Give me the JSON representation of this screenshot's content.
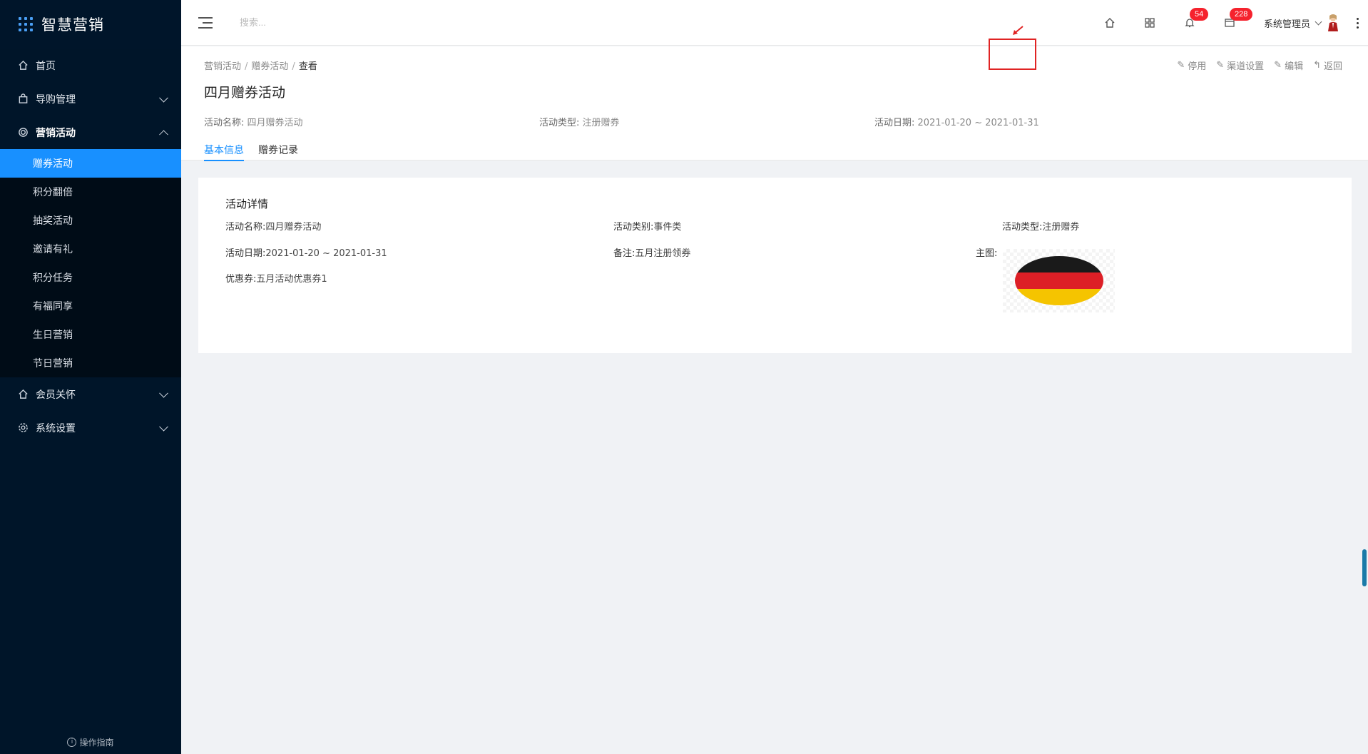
{
  "app": {
    "name": "智慧营销"
  },
  "sidebar": {
    "items": [
      {
        "label": "首页",
        "icon": "home-icon"
      },
      {
        "label": "导购管理",
        "icon": "bag-icon"
      },
      {
        "label": "营销活动",
        "icon": "target-icon"
      },
      {
        "label": "会员关怀",
        "icon": "home-icon"
      },
      {
        "label": "系统设置",
        "icon": "gear-icon"
      }
    ],
    "marketing_sub": [
      "赠券活动",
      "积分翻倍",
      "抽奖活动",
      "邀请有礼",
      "积分任务",
      "有福同享",
      "生日营销",
      "节日营销"
    ],
    "footer": "操作指南"
  },
  "header": {
    "search_placeholder": "搜索...",
    "notifications_count": "54",
    "messages_count": "228",
    "user_name": "系统管理员"
  },
  "breadcrumb": [
    "营销活动",
    "赠券活动",
    "查看"
  ],
  "page_title": "四月赠券活动",
  "actions": {
    "disable": "停用",
    "channel_settings": "渠道设置",
    "edit": "编辑",
    "back": "返回"
  },
  "summary": {
    "name_label": "活动名称:",
    "name_value": "四月赠券活动",
    "type_label": "活动类型:",
    "type_value": "注册赠券",
    "date_label": "活动日期:",
    "date_value": "2021-01-20 ~ 2021-01-31"
  },
  "tabs": [
    "基本信息",
    "赠券记录"
  ],
  "detail": {
    "title": "活动详情",
    "name_label": "活动名称:",
    "name_value": "四月赠券活动",
    "category_label": "活动类别:",
    "category_value": "事件类",
    "type_label": "活动类型:",
    "type_value": "注册赠券",
    "date_label": "活动日期:",
    "date_value": "2021-01-20 ~ 2021-01-31",
    "remark_label": "备注:",
    "remark_value": "五月注册领券",
    "image_label": "主图:",
    "coupon_label": "优惠券:",
    "coupon_value": "五月活动优惠券1"
  },
  "colors": {
    "sidebar_bg": "#001529",
    "accent": "#1890ff",
    "badge": "#f5222d",
    "highlight": "#e02424",
    "flag_black": "#1a1a1a",
    "flag_red": "#dd1f26",
    "flag_gold": "#f5c400"
  }
}
